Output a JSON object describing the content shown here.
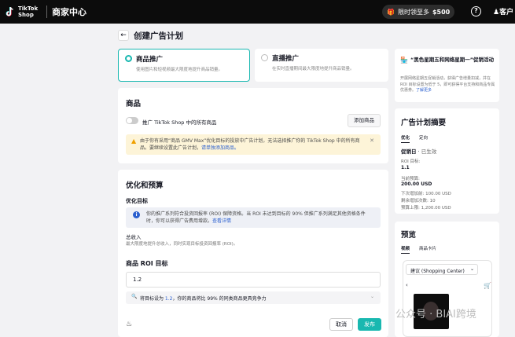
{
  "topbar": {
    "logo_text": "TikTok Shop",
    "app_title": "商家中心",
    "promo_label": "限时领至多",
    "promo_amount": "$500",
    "help_icon": "question-circle-icon",
    "user_label": "客户"
  },
  "page": {
    "back_icon": "arrow-left-icon",
    "title": "创建广告计划"
  },
  "ad_types": [
    {
      "title": "商品推广",
      "desc": "使用图片和短视频最大限度地提升商品销量。",
      "selected": true
    },
    {
      "title": "直播推广",
      "desc": "在实时直播期间最大限度地提升商品销量。",
      "selected": false
    }
  ],
  "product_section": {
    "title": "商品",
    "toggle_label": "推广 TikTok Shop 中的所有商品",
    "add_button": "添加商品",
    "warning": "由于你有采用“商品 GMV Max”优化目标的投放中广告计划，无法选择推广你的 TikTok Shop 中的所有商品。要继续设置此广告计划，",
    "warning_link": "请单独添加商品。"
  },
  "budget_section": {
    "title": "优化和预算",
    "goal_label": "优化目标",
    "info_text": "你的推广系列符合投资回报率 (ROI) 保障资格。当 ROI 未达到目标的 90% 但推广系列满足其他资格条件时，你可以获得广告费用增款。",
    "info_link": "查看详情",
    "gross_label": "总收入",
    "gross_desc": "最大限度地提升总收入，同时实现目标投资回报率 (ROI)。",
    "roi_label": "商品 ROI 目标",
    "roi_value": "1.2",
    "hint_prefix": "将目标设为 ",
    "hint_value": "1.2",
    "hint_suffix": "，你的商品将比 99% 的同类商品更具竞争力",
    "cancel_button": "取消",
    "publish_button": "发布"
  },
  "right_promo": {
    "title": "“黑色星期五和网络星期一”促销活动",
    "body": "开展网络星期五促销活动，获得广告增量扣减，并在 ROI 目标设置为低于 5，即可获得平台支持和商品专属优惠券。",
    "link": "了解更多"
  },
  "summary": {
    "title": "广告计划摘要",
    "tabs": [
      "优化",
      "定向"
    ],
    "status_title": "促销日",
    "status": "已生效",
    "roi_label": "ROI 目标:",
    "roi_value": "1.1",
    "budget_label": "当前预算:",
    "budget_value": "200.00 USD",
    "line1": "下次增加前: 100.00 USD",
    "line2": "剩余增加次数: 10",
    "line3": "预算上限: 1,200.00 USD"
  },
  "preview": {
    "title": "预览",
    "tabs": [
      "视频",
      "商品卡片"
    ],
    "search_text": "建议 (Shopping Center)",
    "watermark": "公众号 · BIAI跨境"
  },
  "colors": {
    "accent": "#19b8b0",
    "topbar": "#0c0c0c",
    "warning_bg": "#fdf4d8",
    "link": "#2b5fcf"
  }
}
